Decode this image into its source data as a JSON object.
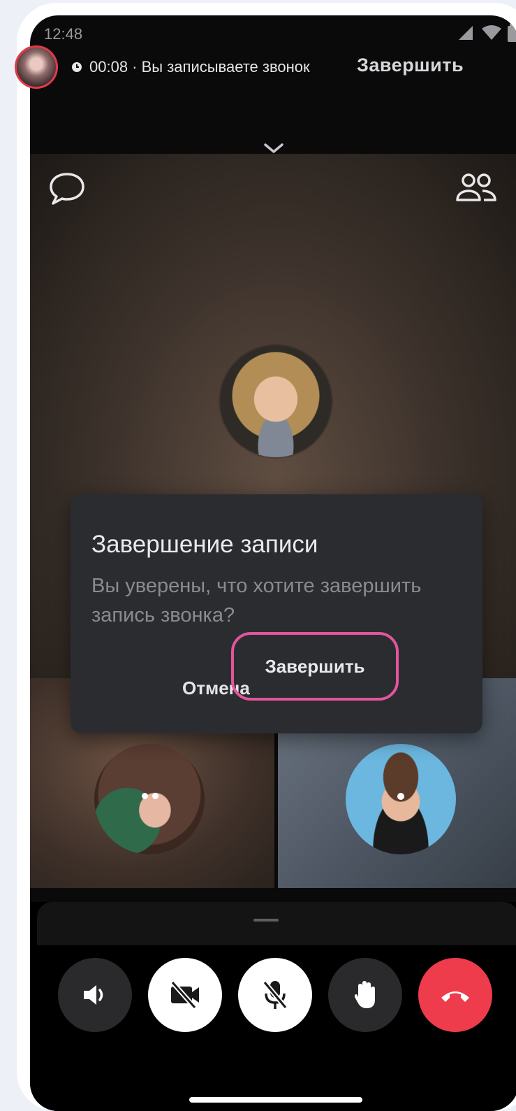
{
  "status_bar": {
    "time": "12:48",
    "icons": [
      "signal-icon",
      "wifi-icon",
      "battery-icon"
    ]
  },
  "call": {
    "timer": "00:08 · Вы записываете звонок",
    "end_label": "Завершить"
  },
  "dialog": {
    "title": "Завершение записи",
    "message": "Вы уверены, что хотите завершить запись звонка?",
    "cancel_label": "Отмена",
    "confirm_label": "Завершить"
  },
  "controls": {
    "items": [
      "speaker-icon",
      "camera-off-icon",
      "mic-off-icon",
      "raise-hand-icon",
      "hang-up-icon"
    ]
  },
  "colors": {
    "recording": "#e23a4a",
    "highlight": "#e2559b",
    "hangup": "#ee3c4c"
  }
}
